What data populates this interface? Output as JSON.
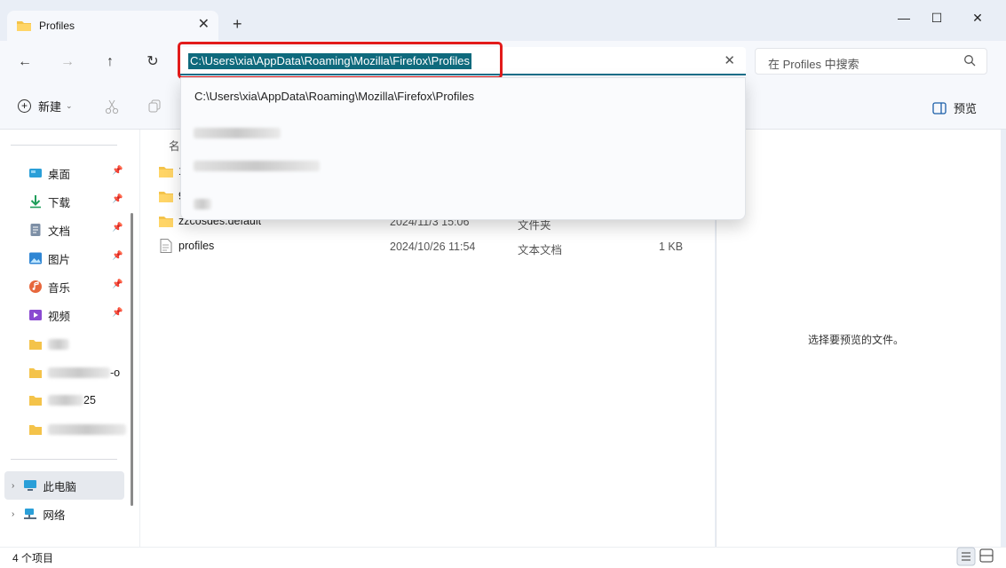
{
  "window": {
    "tab_title": "Profiles",
    "tab_close": "✕",
    "new_tab": "+",
    "minimize": "—",
    "maximize": "☐",
    "close": "✕"
  },
  "nav": {
    "back": "←",
    "forward": "→",
    "up": "↑",
    "refresh": "↻",
    "address_value": "C:\\Users\\xia\\AppData\\Roaming\\Mozilla\\Firefox\\Profiles",
    "address_clear": "✕",
    "search_placeholder": "在 Profiles 中搜索"
  },
  "toolbar": {
    "new_label": "新建",
    "preview_label": "预览"
  },
  "sidebar": {
    "items": [
      {
        "label": "桌面",
        "icon": "desktop-icon"
      },
      {
        "label": "下载",
        "icon": "download-icon"
      },
      {
        "label": "文档",
        "icon": "document-icon"
      },
      {
        "label": "图片",
        "icon": "picture-icon"
      },
      {
        "label": "音乐",
        "icon": "music-icon"
      },
      {
        "label": "视频",
        "icon": "video-icon"
      }
    ],
    "folders_partial": [
      "-o",
      "25"
    ],
    "this_pc": "此电脑",
    "network": "网络"
  },
  "file_list": {
    "header_name_partial": "名",
    "rows_partial": [
      {
        "name": "1",
        "date": "",
        "type": "",
        "size": ""
      },
      {
        "name": "9",
        "date": "",
        "type": "",
        "size": ""
      },
      {
        "name": "zzcosdes.default",
        "date": "2024/11/3 15:06",
        "type": "文件夹",
        "size": ""
      }
    ],
    "rows": [
      {
        "name": "profiles",
        "date": "2024/10/26 11:54",
        "type": "文本文档",
        "size": "1 KB"
      }
    ]
  },
  "dropdown": {
    "suggestion": "C:\\Users\\xia\\AppData\\Roaming\\Mozilla\\Firefox\\Profiles"
  },
  "preview": {
    "empty_text": "选择要预览的文件。"
  },
  "status": {
    "count": "4 个项目"
  },
  "colors": {
    "accent": "#0f6a7d",
    "highlight_box": "#e21b1b",
    "folder": "#f4c34a"
  }
}
